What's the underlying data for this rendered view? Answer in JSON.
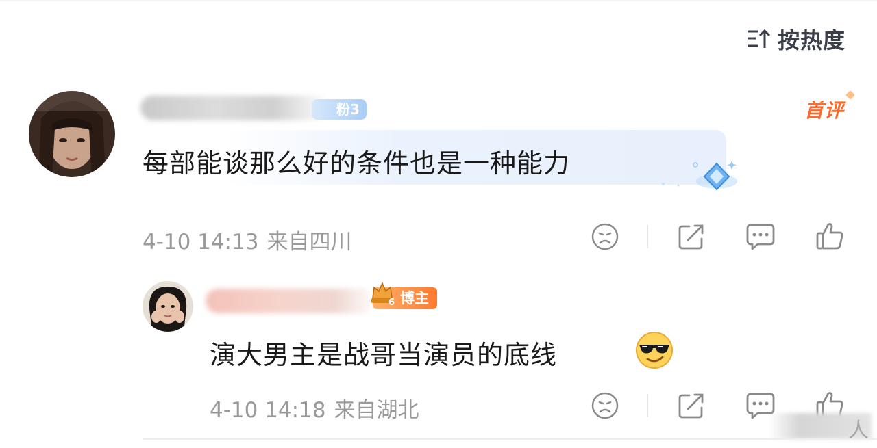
{
  "toolbar": {
    "sort_label": "按热度",
    "sort_icon": "sort-icon"
  },
  "comments": [
    {
      "fan_badge": "粉3",
      "first_badge": "首评",
      "content": "每部能谈那么好的条件也是一种能力",
      "time": "4-10 14:13",
      "location": "来自四川",
      "actions": [
        "dislike-icon",
        "share-icon",
        "comment-icon",
        "like-icon"
      ]
    }
  ],
  "reply": {
    "badge": "博主",
    "content": "演大男主是战哥当演员的底线",
    "emoji": "cool-emoji",
    "time": "4-10 14:18",
    "location": "来自湖北",
    "actions": [
      "dislike-icon",
      "share-icon",
      "comment-icon",
      "like-icon"
    ]
  },
  "watermark": "人",
  "colors": {
    "accent_orange": "#ff6a2a",
    "fan_badge_blue": "#a9cdf6",
    "meta_gray": "#9a9a9a"
  }
}
